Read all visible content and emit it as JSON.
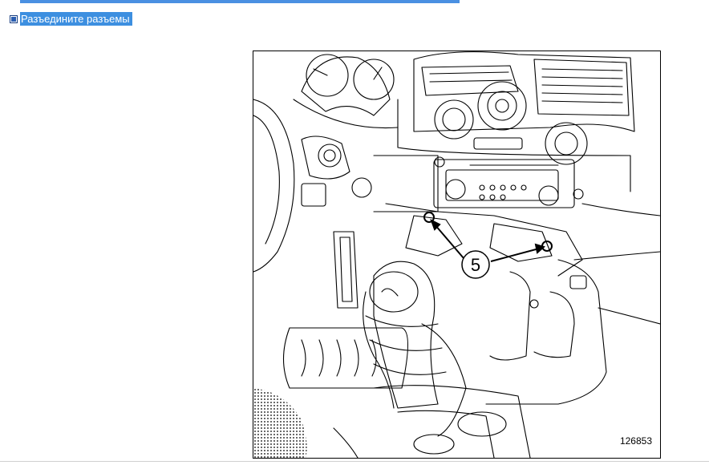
{
  "step": {
    "text": "Разъедините разъемы"
  },
  "figure": {
    "callout_label": "5",
    "figure_number": "126853"
  },
  "colors": {
    "highlight": "#3d8fe0",
    "bullet": "#2a5db0"
  }
}
